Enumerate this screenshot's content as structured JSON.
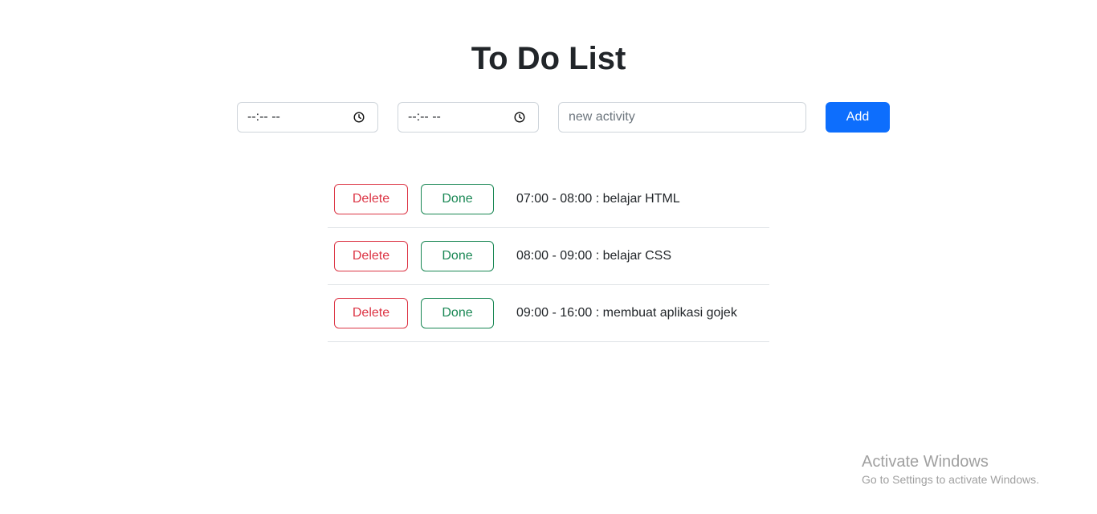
{
  "page": {
    "title": "To Do List"
  },
  "form": {
    "start_time_value": "--:-- --",
    "end_time_value": "--:-- --",
    "activity_placeholder": "new activity",
    "add_label": "Add"
  },
  "todos": [
    {
      "delete_label": "Delete",
      "done_label": "Done",
      "text": "07:00 - 08:00 : belajar HTML"
    },
    {
      "delete_label": "Delete",
      "done_label": "Done",
      "text": "08:00 - 09:00 : belajar CSS"
    },
    {
      "delete_label": "Delete",
      "done_label": "Done",
      "text": "09:00 - 16:00 : membuat aplikasi gojek"
    }
  ],
  "activation": {
    "title": "Activate Windows",
    "subtitle": "Go to Settings to activate Windows."
  },
  "colors": {
    "primary": "#0d6efd",
    "danger": "#dc3545",
    "success": "#198754"
  },
  "icons": {
    "time_icon": "clock-icon"
  }
}
